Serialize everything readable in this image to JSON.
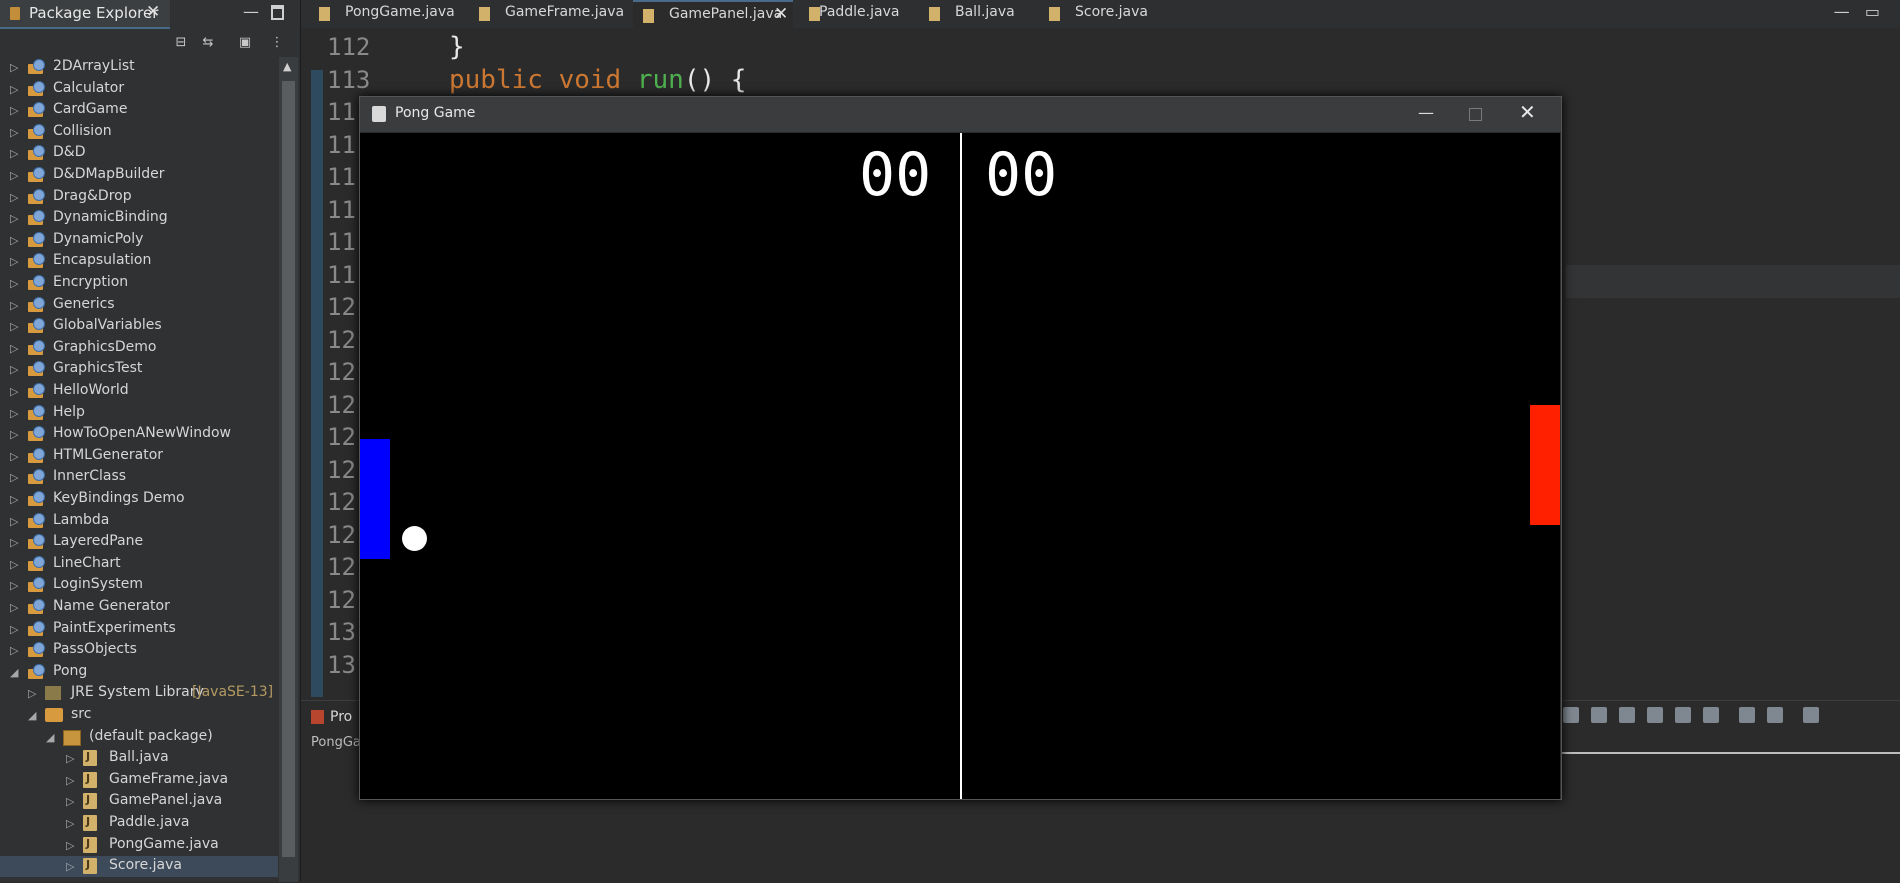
{
  "explorer": {
    "title": "Package Explorer",
    "close_glyph": "✕",
    "projects": [
      "2DArrayList",
      "Calculator",
      "CardGame",
      "Collision",
      "D&D",
      "D&DMapBuilder",
      "Drag&Drop",
      "DynamicBinding",
      "DynamicPoly",
      "Encapsulation",
      "Encryption",
      "Generics",
      "GlobalVariables",
      "GraphicsDemo",
      "GraphicsTest",
      "HelloWorld",
      "Help",
      "HowToOpenANewWindow",
      "HTMLGenerator",
      "InnerClass",
      "KeyBindings Demo",
      "Lambda",
      "LayeredPane",
      "LineChart",
      "LoginSystem",
      "Name Generator",
      "PaintExperiments",
      "PassObjects",
      "Pong"
    ],
    "jre_label": "JRE System Library",
    "jre_version": "[JavaSE-13]",
    "src_label": "src",
    "package_label": "(default package)",
    "files": [
      "Ball.java",
      "GameFrame.java",
      "GamePanel.java",
      "Paddle.java",
      "PongGame.java",
      "Score.java"
    ],
    "selected_file": "Score.java"
  },
  "editor": {
    "tabs": [
      "PongGame.java",
      "GameFrame.java",
      "GamePanel.java",
      "Paddle.java",
      "Ball.java",
      "Score.java"
    ],
    "active_tab": "GamePanel.java",
    "tab_close_glyph": "✕",
    "line_numbers": [
      "112",
      "113",
      "11",
      "11",
      "11",
      "11",
      "11",
      "11",
      "12",
      "12",
      "12",
      "12",
      "12",
      "12",
      "12",
      "12",
      "12",
      "12",
      "13",
      "13"
    ],
    "code_line_112": "}",
    "code_line_113_kw": "public void",
    "code_line_113_fn": "run",
    "code_line_113_rest": "() {"
  },
  "bottom_panel": {
    "tab_label": "Pro",
    "sub_label": "PongGa"
  },
  "pong": {
    "window_title": "Pong Game",
    "score_player1": "00",
    "score_player2": "00",
    "colors": {
      "background": "#000000",
      "left_paddle": "#0000ff",
      "right_paddle": "#ff2000",
      "ball": "#ffffff"
    }
  }
}
